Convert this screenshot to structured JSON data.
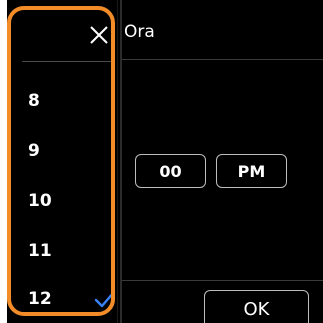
{
  "background": {
    "title": "Ora",
    "minutes_value": "00",
    "ampm_value": "PM",
    "ok_label": "OK"
  },
  "hour_picker": {
    "close_icon": "close-icon",
    "items": [
      {
        "label": "8"
      },
      {
        "label": "9"
      },
      {
        "label": "10"
      },
      {
        "label": "11"
      },
      {
        "label": "12",
        "selected": true
      }
    ],
    "check_icon": "checkmark-icon"
  },
  "colors": {
    "highlight": "#f28c28",
    "check": "#3b82f6",
    "background": "#000000",
    "text": "#ffffff",
    "border": "#bdbdbd"
  }
}
